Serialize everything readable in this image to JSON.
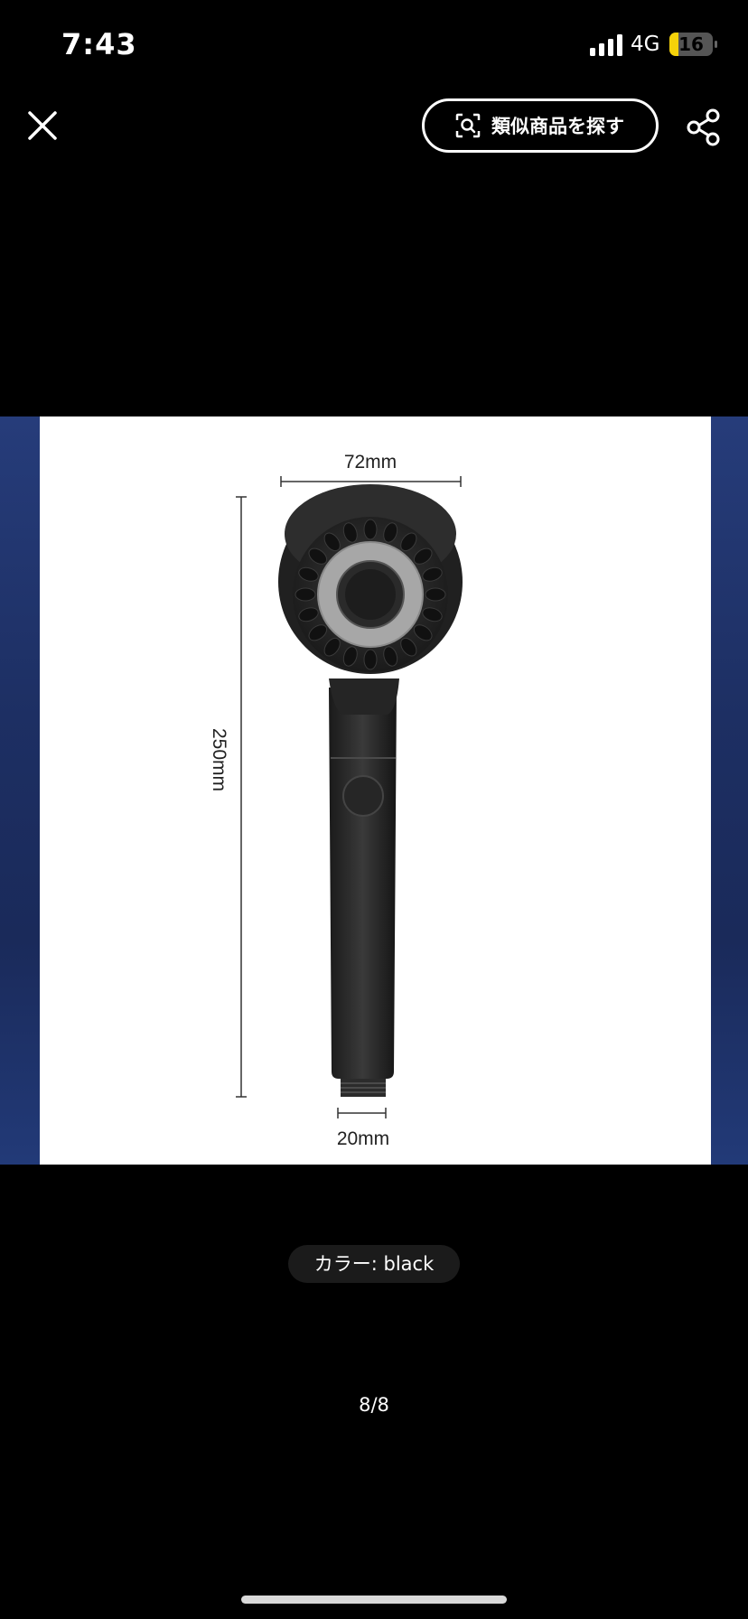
{
  "status_bar": {
    "time": "7:43",
    "network": "4G",
    "battery_level": "16",
    "battery_color": "#f5d20a"
  },
  "toolbar": {
    "close_icon": "close-icon",
    "similar_button_label": "類似商品を探す",
    "similar_icon": "scan-search-icon",
    "share_icon": "share-icon"
  },
  "product_image": {
    "dimension_width_top": "72mm",
    "dimension_height": "250mm",
    "dimension_width_bottom": "20mm"
  },
  "variant": {
    "color_label": "カラー: black"
  },
  "gallery": {
    "position": "8/8"
  }
}
